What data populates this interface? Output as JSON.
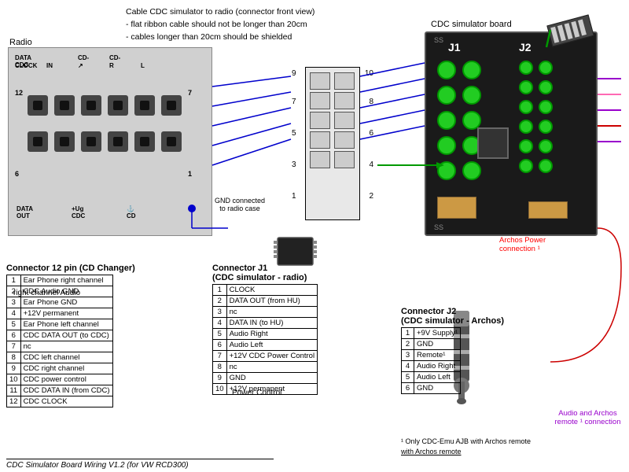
{
  "title": "CDC Simulator Board Wiring V1.2 (for VW RCD300)",
  "top_annotation": {
    "line1": "Cable CDC simulator to radio (connector front view)",
    "line2": "- flat ribbon cable should not be longer than 20cm",
    "line3": "- cables longer than 20cm should be shielded"
  },
  "radio_label": "Radio",
  "cdc_board_label": "CDC simulator board",
  "j1_label": "J1",
  "j2_label": "J2",
  "gnd_text": {
    "line1": "GND connected",
    "line2": "to radio case"
  },
  "archos_power": "Archos Power connection ¹",
  "archos_audio": "Audio and Archos remote ¹ connection",
  "right_channel_label": "right channel Audio",
  "power_control_label": "Power Control",
  "connector_12pin": {
    "title": "Connector 12 pin (CD Changer)",
    "rows": [
      {
        "pin": "1",
        "label": "Ear Phone right channel"
      },
      {
        "pin": "2",
        "label": "CDC Audio GND"
      },
      {
        "pin": "3",
        "label": "Ear Phone GND"
      },
      {
        "pin": "4",
        "label": "+12V permanent"
      },
      {
        "pin": "5",
        "label": "Ear Phone left channel"
      },
      {
        "pin": "6",
        "label": "CDC DATA OUT (to CDC)"
      },
      {
        "pin": "7",
        "label": "nc"
      },
      {
        "pin": "8",
        "label": "CDC left channel"
      },
      {
        "pin": "9",
        "label": "CDC right channel"
      },
      {
        "pin": "10",
        "label": "CDC power control"
      },
      {
        "pin": "11",
        "label": "CDC DATA IN (from CDC)"
      },
      {
        "pin": "12",
        "label": "CDC CLOCK"
      }
    ]
  },
  "connector_j1": {
    "title": "Connector J1",
    "subtitle": "(CDC simulator - radio)",
    "rows": [
      {
        "pin": "1",
        "label": "CLOCK"
      },
      {
        "pin": "2",
        "label": "DATA OUT (from HU)"
      },
      {
        "pin": "3",
        "label": "nc"
      },
      {
        "pin": "4",
        "label": "DATA IN (to HU)"
      },
      {
        "pin": "5",
        "label": "Audio Right"
      },
      {
        "pin": "6",
        "label": "Audio Left"
      },
      {
        "pin": "7",
        "label": "+12V CDC Power Control"
      },
      {
        "pin": "8",
        "label": "nc"
      },
      {
        "pin": "9",
        "label": "GND"
      },
      {
        "pin": "10",
        "label": "+12V permanent"
      }
    ]
  },
  "connector_j2": {
    "title": "Connector J2",
    "subtitle": "(CDC simulator - Archos)",
    "rows": [
      {
        "pin": "1",
        "label": "+9V Supply¹"
      },
      {
        "pin": "2",
        "label": "GND"
      },
      {
        "pin": "3",
        "label": "Remote¹"
      },
      {
        "pin": "4",
        "label": "Audio Right"
      },
      {
        "pin": "5",
        "label": "Audio Left"
      },
      {
        "pin": "6",
        "label": "GND"
      }
    ]
  },
  "only_cdc_note": "¹ Only CDC-Emu AJB with Archos remote",
  "radio_connector_labels": {
    "data_cdc": "DATA CDC",
    "clock": "CLOCK",
    "in": "IN",
    "cd_r": "CD-R",
    "cd_l": "CD-L",
    "data_out": "DATA OUT",
    "plus_ug": "+Ug",
    "cd": "CD"
  },
  "pin_numbers": {
    "left_top": "12",
    "right_top": "7",
    "left_bottom": "6",
    "right_bottom": "1"
  },
  "central_connector_numbers_left": [
    "9",
    "7",
    "5",
    "3",
    "1"
  ],
  "central_connector_numbers_right": [
    "10",
    "8",
    "6",
    "4",
    "2"
  ],
  "colors": {
    "background": "#ffffff",
    "radio_box": "#d0d0d0",
    "cdc_board": "#1a1a1a",
    "green_pin": "#22cc22",
    "wire_blue": "#0000cc",
    "wire_red": "#cc0000",
    "wire_purple": "#9900cc",
    "wire_green": "#009900",
    "wire_pink": "#ff69b4"
  }
}
